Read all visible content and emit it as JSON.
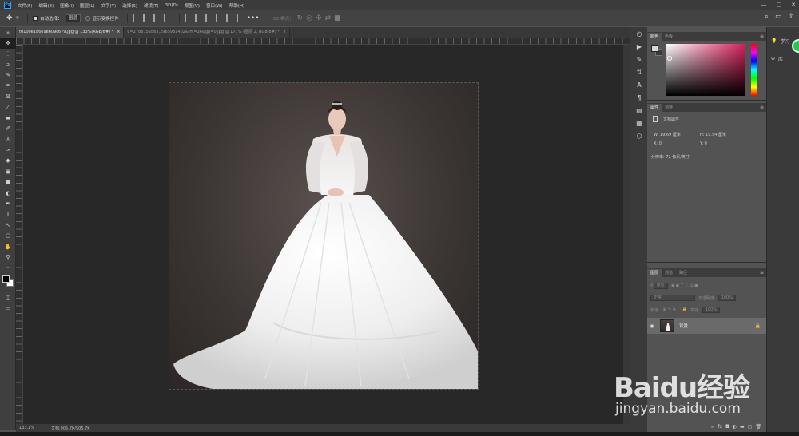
{
  "menu": {
    "logo": "Ps",
    "items": [
      "文件(F)",
      "编辑(E)",
      "图像(I)",
      "图层(L)",
      "文字(Y)",
      "选择(S)",
      "滤镜(T)",
      "3D(D)",
      "视图(V)",
      "窗口(W)",
      "帮助(H)"
    ],
    "window_controls": [
      "—",
      "□",
      "✕"
    ]
  },
  "options": {
    "auto_select_label": "自动选择：",
    "auto_select_value": "图层",
    "show_transform_label": "显示变换控件",
    "mode_3d_label": "3D 模式："
  },
  "tabs": [
    {
      "label": "t0100e18669e609c679.jpg @ 133%(RGB/8#) *",
      "close": "×"
    },
    {
      "label": "u=2788152863,2965981402&fm=26&gp=0.jpg @ 177% (图层 2, RGB/8#) *",
      "close": "×"
    }
  ],
  "status": {
    "zoom": "133.1%",
    "doc_size": "文档:905.7K/905.7K",
    "arrow": "›"
  },
  "color_panel": {
    "tabs": [
      "颜色",
      "色板"
    ],
    "menu": "≡"
  },
  "properties_panel": {
    "tabs": [
      "属性",
      "调整"
    ],
    "title": "文档属性",
    "w": "W: 19.69 厘米",
    "h": "H: 19.54 厘米",
    "x": "X: 0",
    "y": "Y: 0",
    "resolution": "分辨率: 72 像素/英寸"
  },
  "layers_panel": {
    "tabs": [
      "图层",
      "通道",
      "路径"
    ],
    "kind": "类型",
    "blend_mode": "正常",
    "opacity_label": "不透明度:",
    "opacity_value": "100%",
    "lock_label": "锁定:",
    "fill_label": "填充:",
    "fill_value": "100%",
    "layer_name": "背景"
  },
  "far_right": {
    "learn_label": "学习",
    "library_label": "库"
  },
  "watermark": {
    "logo": "Baidu经验",
    "url": "jingyan.baidu.com"
  },
  "icons": {
    "tools": [
      "move-icon",
      "marquee-icon",
      "lasso-icon",
      "quick-select-icon",
      "crop-icon",
      "frame-icon",
      "eyedropper-icon",
      "healing-brush-icon",
      "brush-icon",
      "clone-stamp-icon",
      "history-brush-icon",
      "eraser-icon",
      "gradient-icon",
      "blur-icon",
      "dodge-icon",
      "pen-icon",
      "type-icon",
      "path-select-icon",
      "shape-icon",
      "hand-icon",
      "zoom-icon",
      "more-tools-icon"
    ]
  }
}
